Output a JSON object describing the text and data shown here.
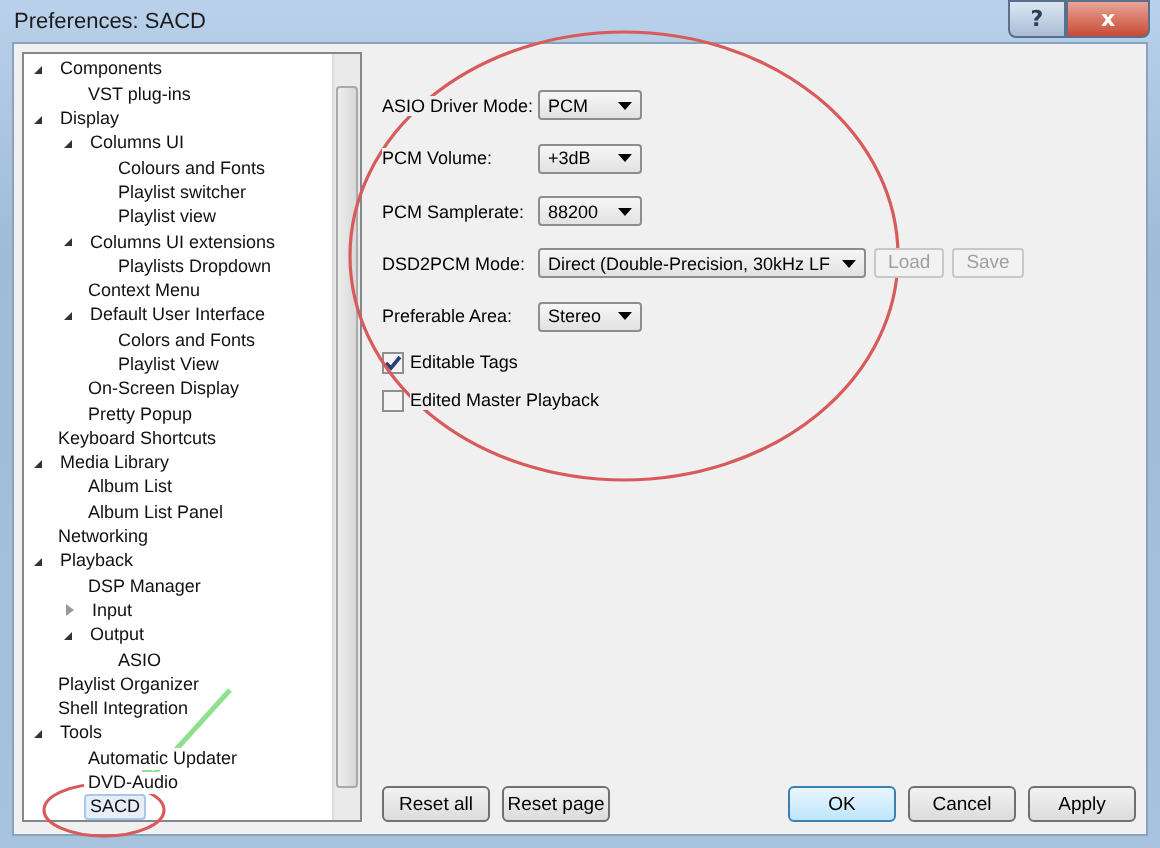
{
  "window": {
    "title": "Preferences: SACD",
    "buttons": [
      {
        "kind": "help",
        "label": "?"
      },
      {
        "kind": "close",
        "label": "x"
      }
    ]
  },
  "tree": [
    {
      "label": "Components",
      "expanded": true,
      "selected": false,
      "children": [
        {
          "label": "VST plug-ins",
          "selected": false
        }
      ]
    },
    {
      "label": "Display",
      "expanded": true,
      "selected": false,
      "children": [
        {
          "label": "Columns UI",
          "expanded": true,
          "selected": false,
          "children": [
            {
              "label": "Colours and Fonts",
              "selected": false
            },
            {
              "label": "Playlist switcher",
              "selected": false
            },
            {
              "label": "Playlist view",
              "selected": false
            }
          ]
        },
        {
          "label": "Columns UI extensions",
          "expanded": true,
          "selected": false,
          "children": [
            {
              "label": "Playlists Dropdown",
              "selected": false
            }
          ]
        },
        {
          "label": "Context Menu",
          "selected": false
        },
        {
          "label": "Default User Interface",
          "expanded": true,
          "selected": false,
          "children": [
            {
              "label": "Colors and Fonts",
              "selected": false
            },
            {
              "label": "Playlist View",
              "selected": false
            }
          ]
        },
        {
          "label": "On-Screen Display",
          "selected": false
        },
        {
          "label": "Pretty Popup",
          "selected": false
        }
      ]
    },
    {
      "label": "Keyboard Shortcuts",
      "selected": false
    },
    {
      "label": "Media Library",
      "expanded": true,
      "selected": false,
      "children": [
        {
          "label": "Album List",
          "selected": false
        },
        {
          "label": "Album List Panel",
          "selected": false
        }
      ]
    },
    {
      "label": "Networking",
      "selected": false
    },
    {
      "label": "Playback",
      "expanded": true,
      "selected": false,
      "children": [
        {
          "label": "DSP Manager",
          "selected": false
        },
        {
          "label": "Input",
          "expanded": false,
          "selected": false
        },
        {
          "label": "Output",
          "expanded": true,
          "selected": false,
          "children": [
            {
              "label": "ASIO",
              "selected": false
            }
          ]
        }
      ]
    },
    {
      "label": "Playlist Organizer",
      "selected": false
    },
    {
      "label": "Shell Integration",
      "selected": false
    },
    {
      "label": "Tools",
      "expanded": true,
      "selected": false,
      "children": [
        {
          "label": "Automatic Updater",
          "selected": false
        },
        {
          "label": "DVD-Audio",
          "selected": false
        },
        {
          "label": "SACD",
          "selected": true
        }
      ]
    }
  ],
  "settings": [
    {
      "kind": "dropdown",
      "label": "ASIO Driver Mode:",
      "value": "PCM"
    },
    {
      "kind": "dropdown",
      "label": "PCM Volume:",
      "value": "+3dB"
    },
    {
      "kind": "dropdown",
      "label": "PCM Samplerate:",
      "value": "88200"
    },
    {
      "kind": "dropdown",
      "label": "DSD2PCM Mode:",
      "value": "Direct (Double-Precision, 30kHz LF",
      "extra_buttons": [
        {
          "label": "Load",
          "disabled": true
        },
        {
          "label": "Save",
          "disabled": true
        }
      ]
    },
    {
      "kind": "dropdown",
      "label": "Preferable Area:",
      "value": "Stereo"
    },
    {
      "kind": "checkbox",
      "label": "Editable Tags",
      "checked": true
    },
    {
      "kind": "checkbox",
      "label": "Edited Master Playback",
      "checked": false
    }
  ],
  "footer_buttons": [
    {
      "label": "Reset all",
      "default": false
    },
    {
      "label": "Reset page",
      "default": false
    },
    {
      "label": "OK",
      "default": true
    },
    {
      "label": "Cancel",
      "default": false
    },
    {
      "label": "Apply",
      "default": false
    }
  ]
}
